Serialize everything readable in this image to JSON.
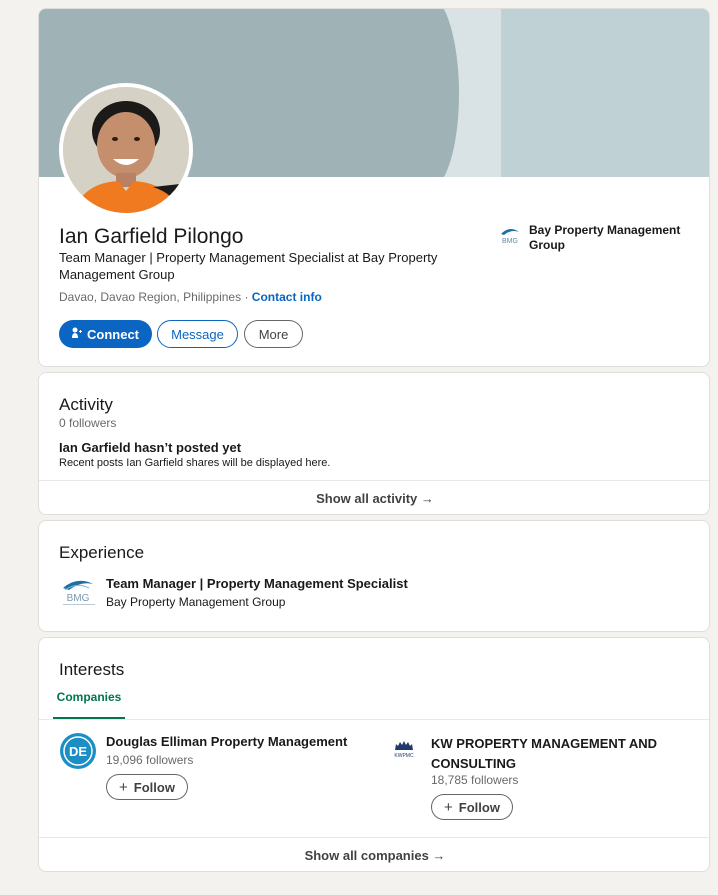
{
  "profile": {
    "name": "Ian Garfield Pilongo",
    "headline": "Team Manager | Property Management Specialist at Bay Property Management Group",
    "location": "Davao, Davao Region, Philippines",
    "separator": " · ",
    "contact_link": "Contact info",
    "buttons": {
      "connect": "Connect",
      "message": "Message",
      "more": "More"
    },
    "current_company": "Bay Property Management Group",
    "company_logo_text": "BMG"
  },
  "activity": {
    "title": "Activity",
    "followers": "0 followers",
    "empty_title": "Ian Garfield hasn’t posted yet",
    "empty_desc": "Recent posts Ian Garfield shares will be displayed here.",
    "show_all": "Show all activity →"
  },
  "experience": {
    "title": "Experience",
    "items": [
      {
        "role": "Team Manager | Property Management Specialist",
        "company": "Bay Property Management Group",
        "logo": "BMG"
      }
    ]
  },
  "interests": {
    "title": "Interests",
    "tabs": [
      {
        "label": "Companies",
        "active": true
      }
    ],
    "companies": [
      {
        "name": "Douglas Elliman Property Management",
        "followers": "19,096 followers",
        "follow": "Follow",
        "logo": "DE"
      },
      {
        "name": "KW PROPERTY MANAGEMENT AND CONSULTING",
        "followers": "18,785 followers",
        "follow": "Follow",
        "logo": "KWPMC"
      }
    ],
    "show_all": "Show all companies →"
  },
  "colors": {
    "accent": "#0a66c2",
    "tab_active": "#01754f",
    "background": "#f4f2ee",
    "banner_light": "#bfd1d5",
    "banner_dark": "#9fb2b6",
    "shirt_orange": "#ef7a1f"
  },
  "icons": [
    "connect-person-icon",
    "plus-icon",
    "arrow-right-icon",
    "bmg-logo-icon",
    "douglas-elliman-logo-icon",
    "kw-logo-icon"
  ]
}
